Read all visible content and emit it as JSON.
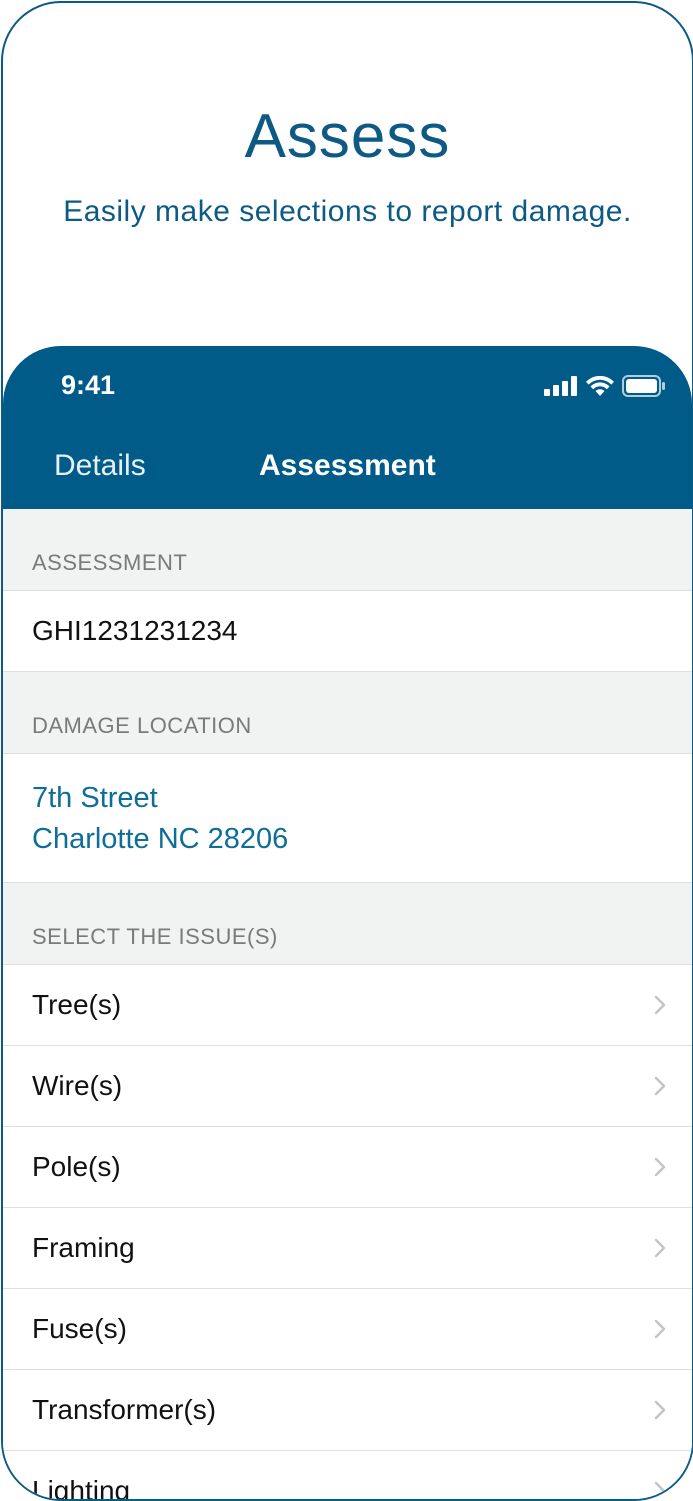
{
  "promo": {
    "title": "Assess",
    "subtitle": "Easily make selections to report damage."
  },
  "status_bar": {
    "time": "9:41",
    "icons": [
      "cellular-signal-icon",
      "wifi-icon",
      "battery-icon"
    ]
  },
  "nav": {
    "tabs": [
      {
        "label": "Details",
        "active": false
      },
      {
        "label": "Assessment",
        "active": true
      }
    ]
  },
  "sections": {
    "assessment_header": "ASSESSMENT",
    "assessment_value": "GHI1231231234",
    "damage_location_header": "DAMAGE LOCATION",
    "damage_location_line1": "7th Street",
    "damage_location_line2": "Charlotte NC 28206",
    "issues_header": "SELECT THE ISSUE(S)"
  },
  "issues": [
    {
      "label": "Tree(s)"
    },
    {
      "label": "Wire(s)"
    },
    {
      "label": "Pole(s)"
    },
    {
      "label": "Framing"
    },
    {
      "label": "Fuse(s)"
    },
    {
      "label": "Transformer(s)"
    },
    {
      "label": "Lighting"
    }
  ],
  "colors": {
    "brand_blue": "#005b88",
    "link_blue": "#0e6e97",
    "section_bg": "#f1f2f2"
  }
}
